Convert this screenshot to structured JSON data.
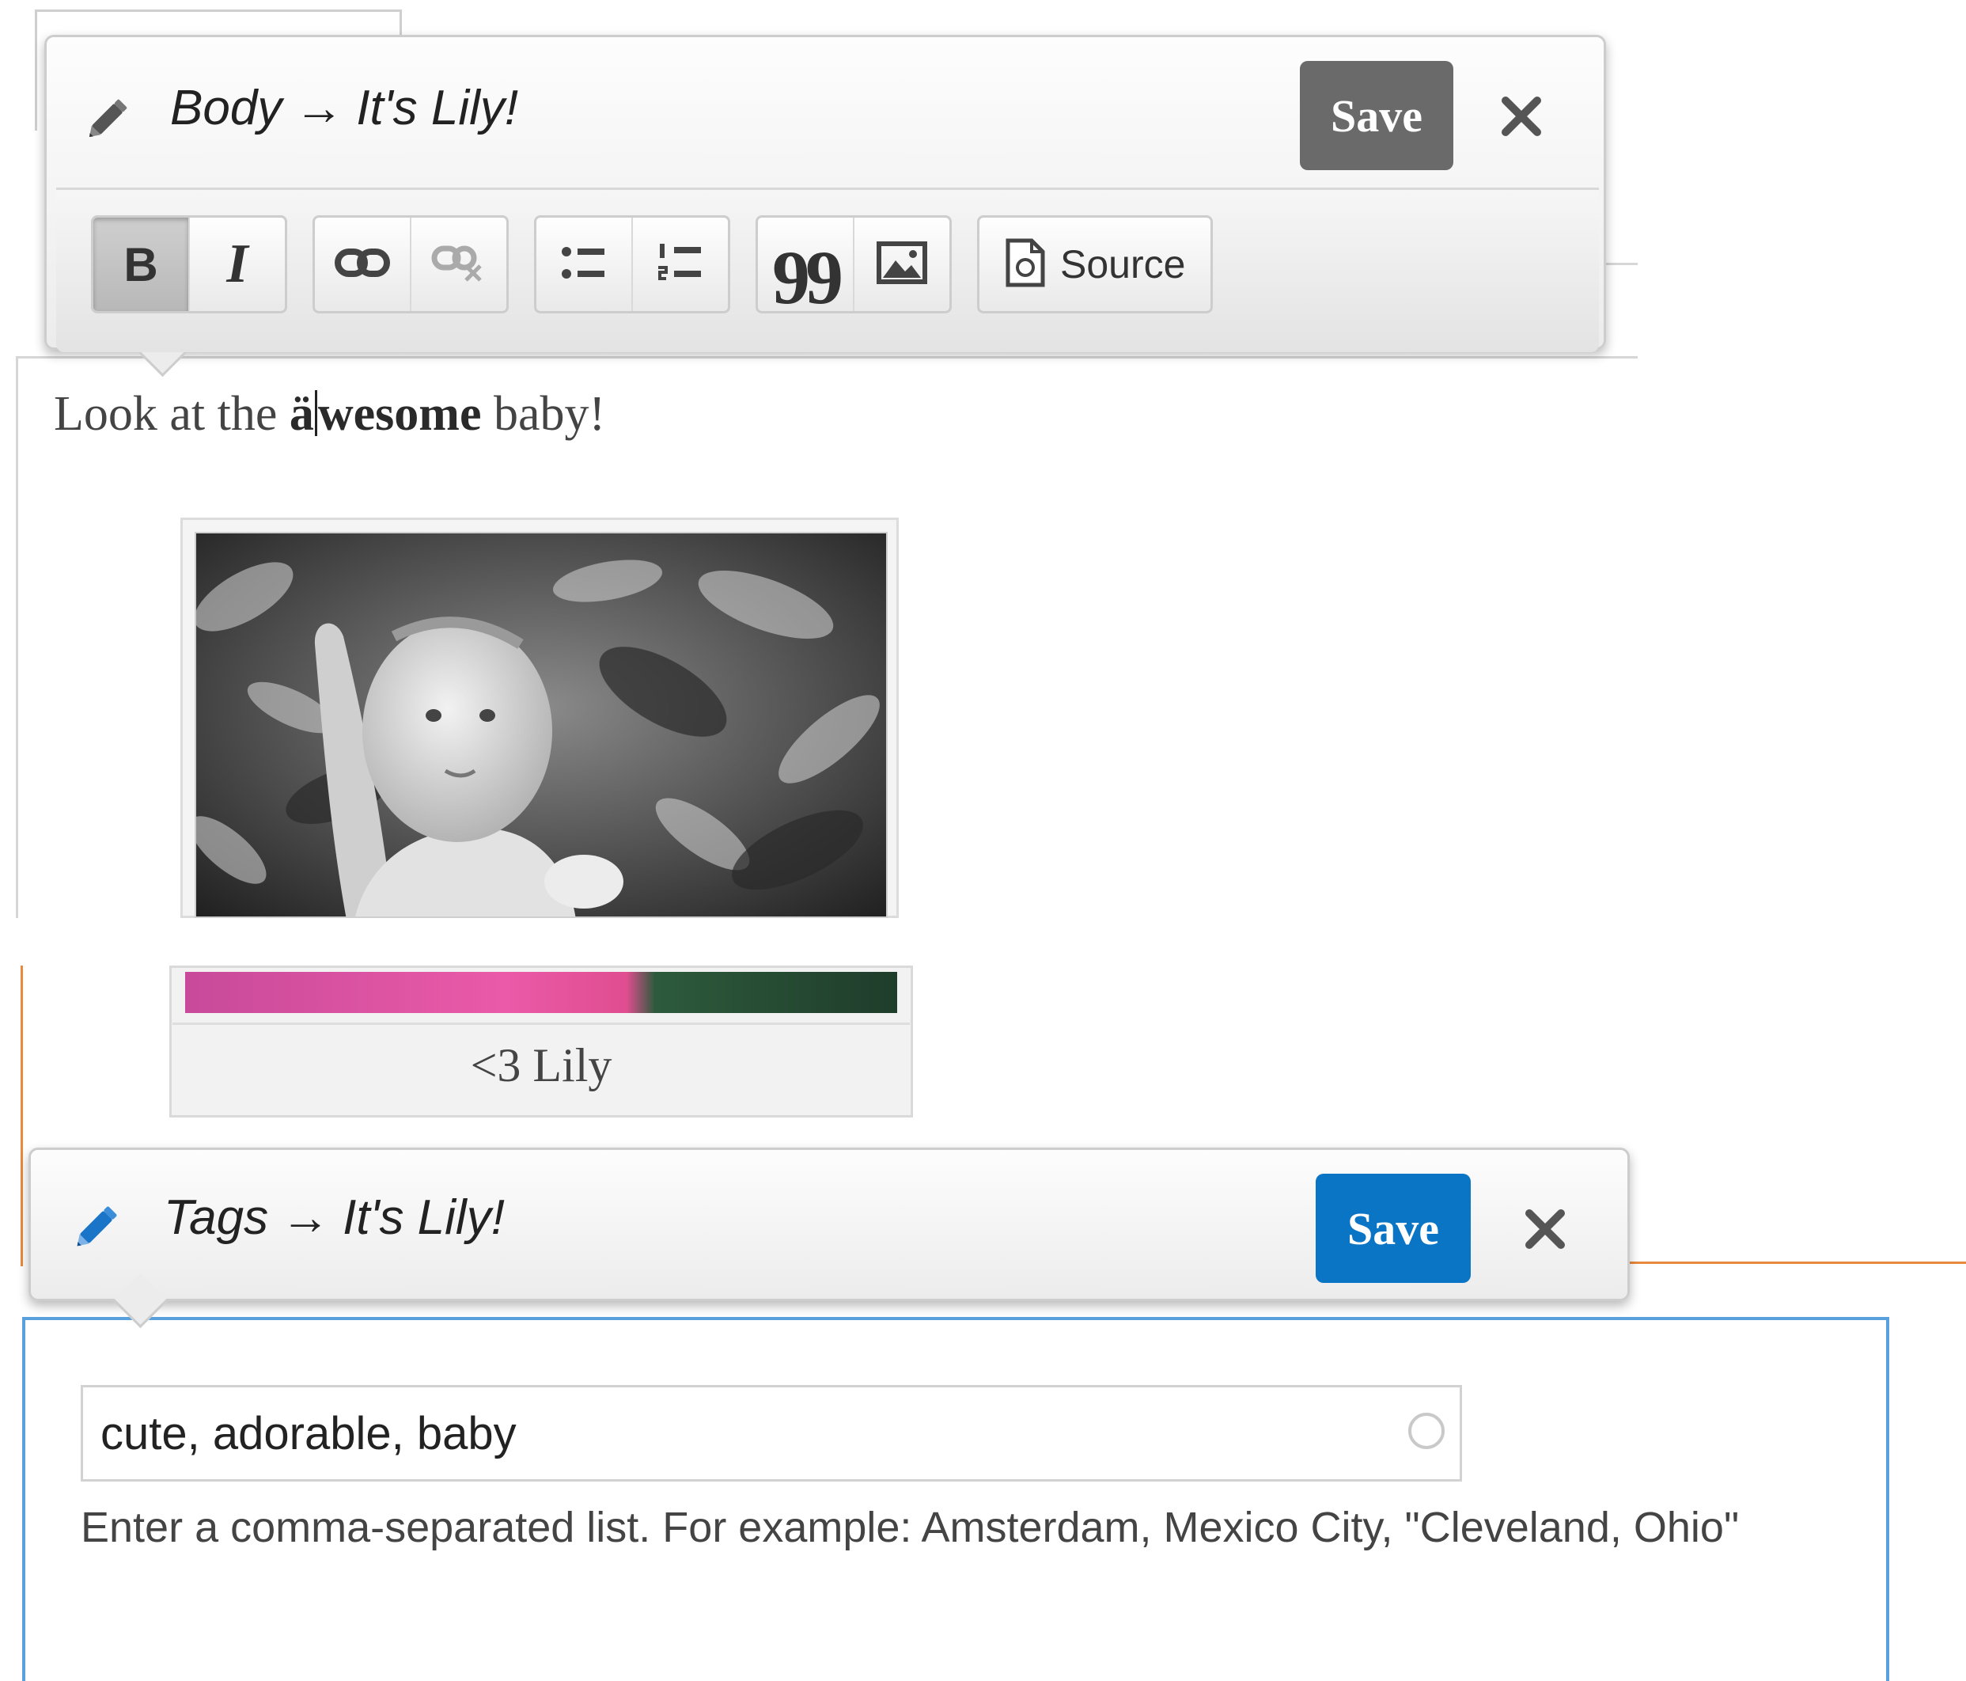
{
  "body_editor": {
    "field": "Body",
    "arrow": "→",
    "entity": "It's Lily!",
    "save_label": "Save",
    "close_glyph": "✕",
    "toolbar": {
      "bold_label": "B",
      "italic_label": "I",
      "blockquote_glyph": "99",
      "source_label": "Source"
    }
  },
  "content": {
    "sentence_before": "Look at the ",
    "bold_before_caret": "ä",
    "bold_after_caret": "wesome",
    "sentence_after": " baby!",
    "image_caption": "<3 Lily"
  },
  "tags_editor": {
    "field": "Tags",
    "arrow": "→",
    "entity": "It's Lily!",
    "save_label": "Save",
    "close_glyph": "✕",
    "input_value": "cute, adorable, baby",
    "help_text": "Enter a comma-separated list. For example: Amsterdam, Mexico City, \"Cleveland, Ohio\""
  },
  "colors": {
    "save_dark": "#6a6a6a",
    "save_blue": "#0a74c5",
    "focus_border": "#5aa0dc",
    "accent_orange": "#e9893e"
  },
  "icons": {
    "pencil": "pencil-icon",
    "close": "close-icon",
    "link": "link-icon",
    "unlink": "unlink-icon",
    "bulleted_list": "bulleted-list-icon",
    "numbered_list": "numbered-list-icon",
    "blockquote": "blockquote-icon",
    "image": "image-icon",
    "source": "source-document-icon",
    "throbber": "throbber-icon"
  }
}
